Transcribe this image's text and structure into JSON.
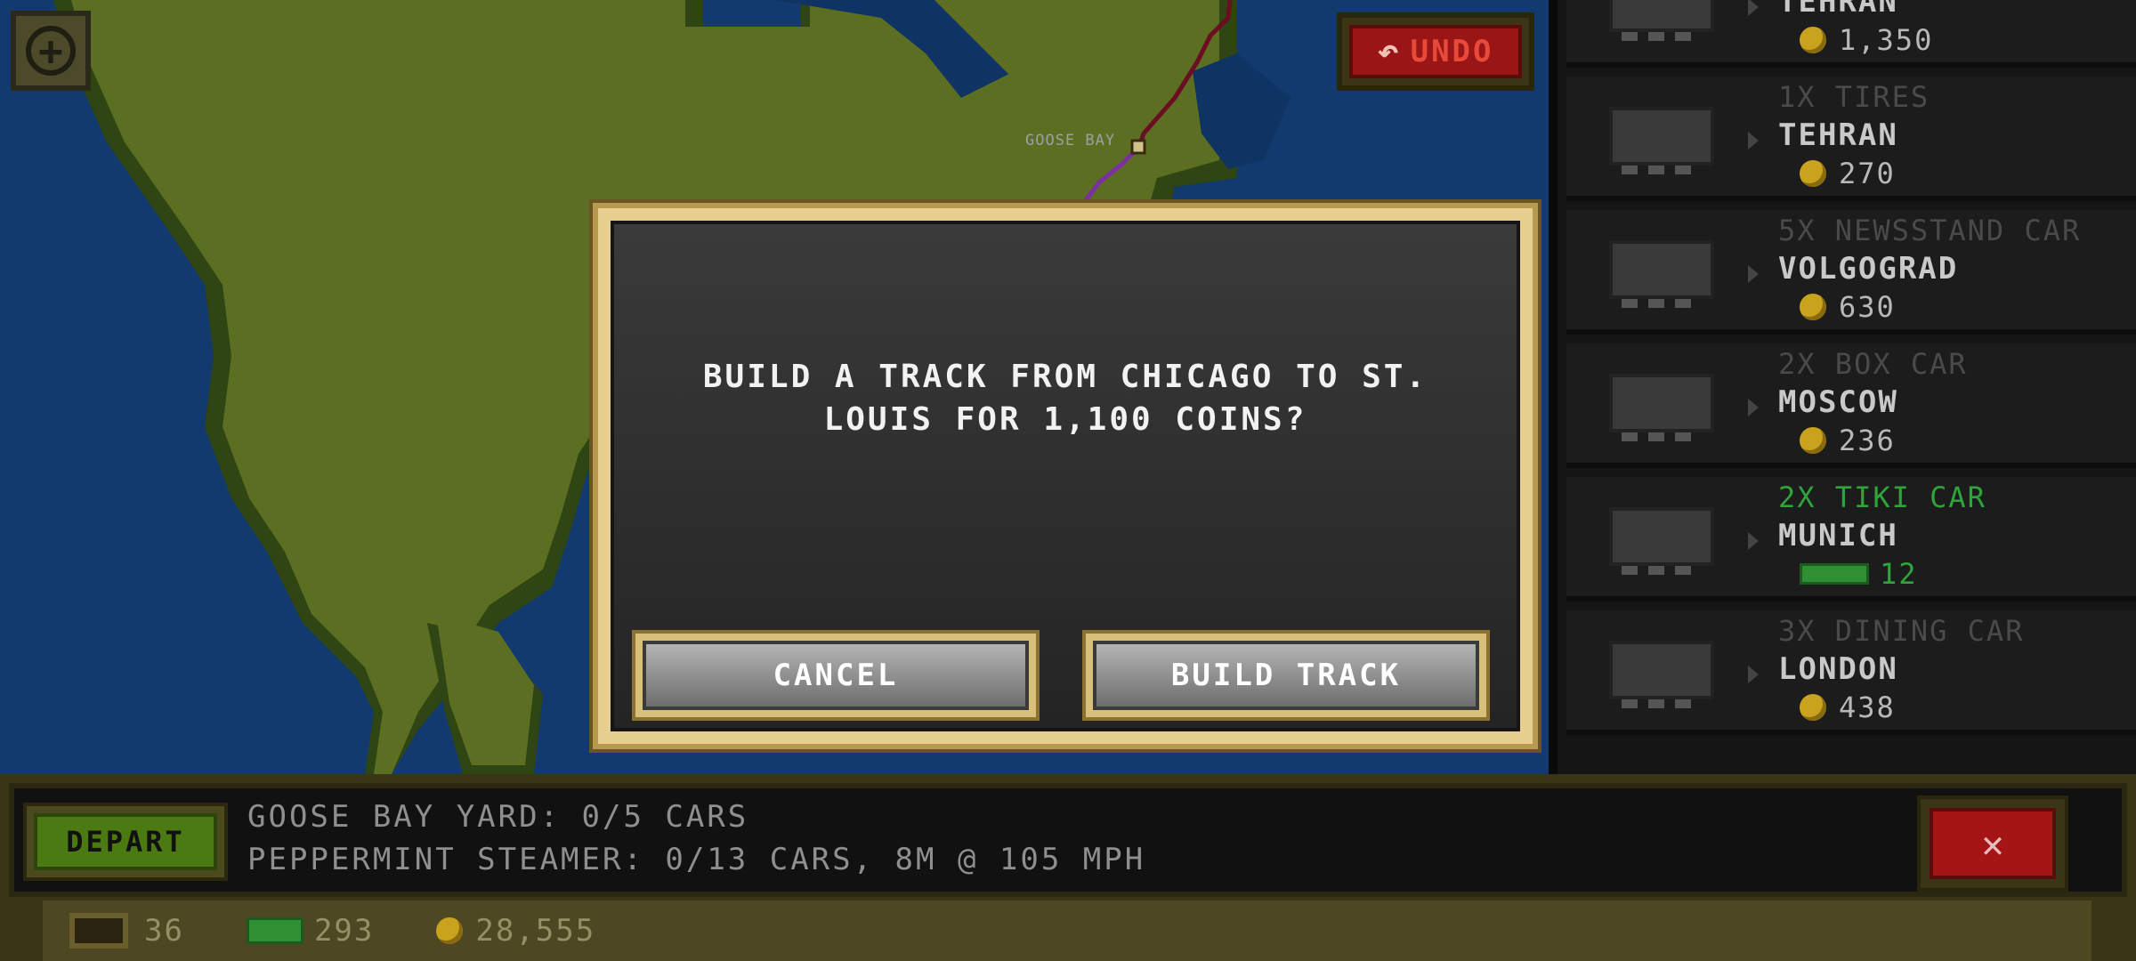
{
  "map": {
    "city_label": "GOOSE BAY",
    "undo_label": "UNDO",
    "zoom_icon": "plus-circle-icon"
  },
  "offers": [
    {
      "item": "",
      "destination": "TEHRAN",
      "price": "1,350",
      "price_type": "coin"
    },
    {
      "item": "1X TIRES",
      "destination": "TEHRAN",
      "price": "270",
      "price_type": "coin"
    },
    {
      "item": "5X NEWSSTAND CAR",
      "destination": "VOLGOGRAD",
      "price": "630",
      "price_type": "coin"
    },
    {
      "item": "2X BOX CAR",
      "destination": "MOSCOW",
      "price": "236",
      "price_type": "coin"
    },
    {
      "item": "2X TIKI CAR",
      "destination": "MUNICH",
      "price": "12",
      "price_type": "cash"
    },
    {
      "item": "3X DINING CAR",
      "destination": "LONDON",
      "price": "438",
      "price_type": "coin"
    }
  ],
  "dialog": {
    "message": "BUILD A TRACK FROM CHICAGO TO ST. LOUIS FOR 1,100 COINS?",
    "cancel_label": "CANCEL",
    "confirm_label": "BUILD TRACK"
  },
  "bottom_bar": {
    "depart_label": "DEPART",
    "yard_status": "GOOSE BAY YARD: 0/5 CARS",
    "train_status": "PEPPERMINT STEAMER: 0/13 CARS, 8M @ 105 MPH",
    "close_label": "✕"
  },
  "stats": {
    "cars": "36",
    "cash": "293",
    "coins": "28,555"
  },
  "colors": {
    "ocean": "#123a6e",
    "land": "#5a6e22",
    "dialog_frame": "#e6cf8f",
    "undo_red": "#9a1515",
    "depart_green": "#4b7a12",
    "tiki_green": "#2fa43a"
  }
}
